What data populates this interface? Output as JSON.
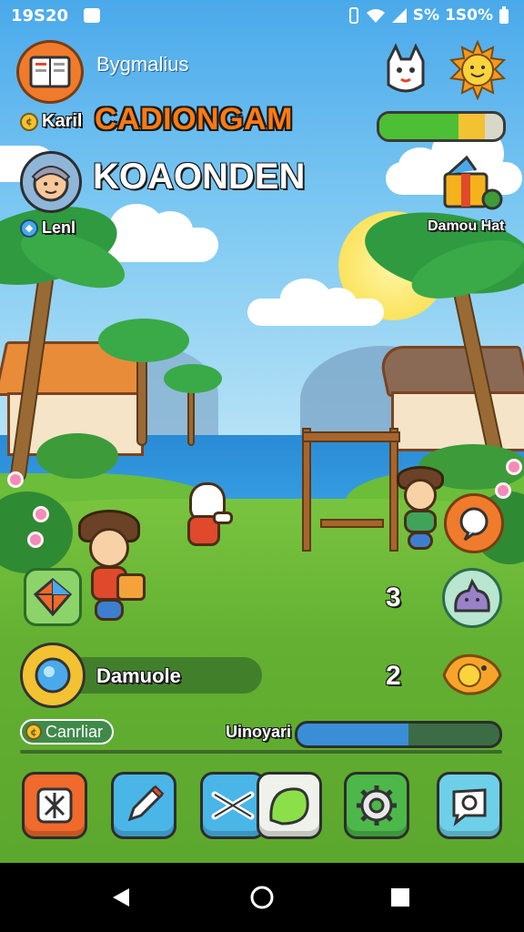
{
  "status_bar": {
    "time": "19S20",
    "signal_text": "S%",
    "battery_text": "1S0%"
  },
  "hud": {
    "top_subtitle": "Bygmalius",
    "player_prefix": "Karil",
    "game_title": "CADIONGAM",
    "player_name": "KOAONDEN",
    "level_label": "Lenl",
    "right_label": "Damou Hat",
    "progress_top": 0.85,
    "colors": {
      "accent_orange": "#ff7a12",
      "progress_green": "#4cbf34",
      "progress_yellow": "#f3c232"
    }
  },
  "side_counts": {
    "pet_count": "3",
    "fish_count": "2"
  },
  "panels": {
    "action_label": "Damuole",
    "left_pill_label": "Canrliar",
    "bottom_progress_label": "Uinoyari",
    "bottom_progress": 0.55
  },
  "dock": {
    "buttons": [
      "grid-icon",
      "pen-icon",
      "scissors-icon",
      "leaf-icon",
      "gear-icon",
      "chat-icon"
    ]
  }
}
